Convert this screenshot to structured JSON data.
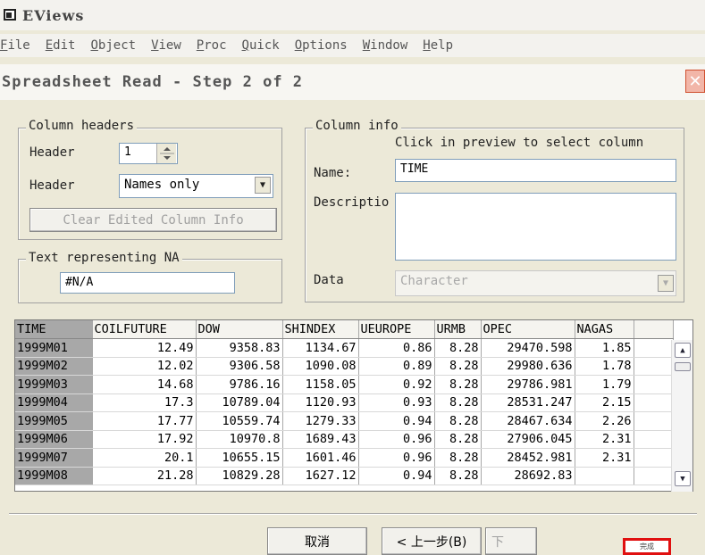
{
  "app": {
    "title": "EViews"
  },
  "menu": [
    {
      "label": "File",
      "underline": "F",
      "rest": "ile"
    },
    {
      "label": "Edit",
      "underline": "E",
      "rest": "dit"
    },
    {
      "label": "Object",
      "underline": "O",
      "rest": "bject"
    },
    {
      "label": "View",
      "underline": "V",
      "rest": "iew"
    },
    {
      "label": "Proc",
      "underline": "P",
      "rest": "roc"
    },
    {
      "label": "Quick",
      "underline": "Q",
      "rest": "uick"
    },
    {
      "label": "Options",
      "underline": "O",
      "rest": "ptions"
    },
    {
      "label": "Window",
      "underline": "W",
      "rest": "indow"
    },
    {
      "label": "Help",
      "underline": "H",
      "rest": "elp"
    }
  ],
  "dialog": {
    "title": "Spreadsheet Read - Step 2 of 2",
    "close_glyph": "✕"
  },
  "column_headers": {
    "legend": "Column headers",
    "header_label": "Header",
    "header_value": "1",
    "header_type_label": "Header",
    "header_type_value": "Names only",
    "clear_button": "Clear Edited Column Info"
  },
  "text_na": {
    "legend": "Text representing NA",
    "value": "#N/A"
  },
  "column_info": {
    "legend": "Column info",
    "hint": "Click in preview to select column",
    "name_label": "Name:",
    "name_value": "TIME",
    "description_label": "Descriptio",
    "description_value": "",
    "data_label": "Data",
    "data_value": "Character"
  },
  "grid": {
    "columns": [
      "TIME",
      "COILFUTURE",
      "DOW",
      "SHINDEX",
      "UEUROPE",
      "URMB",
      "OPEC",
      "NAGAS"
    ],
    "rows": [
      [
        "1999M01",
        "12.49",
        "9358.83",
        "1134.67",
        "0.86",
        "8.28",
        "29470.598",
        "1.85"
      ],
      [
        "1999M02",
        "12.02",
        "9306.58",
        "1090.08",
        "0.89",
        "8.28",
        "29980.636",
        "1.78"
      ],
      [
        "1999M03",
        "14.68",
        "9786.16",
        "1158.05",
        "0.92",
        "8.28",
        "29786.981",
        "1.79"
      ],
      [
        "1999M04",
        "17.3",
        "10789.04",
        "1120.93",
        "0.93",
        "8.28",
        "28531.247",
        "2.15"
      ],
      [
        "1999M05",
        "17.77",
        "10559.74",
        "1279.33",
        "0.94",
        "8.28",
        "28467.634",
        "2.26"
      ],
      [
        "1999M06",
        "17.92",
        "10970.8",
        "1689.43",
        "0.96",
        "8.28",
        "27906.045",
        "2.31"
      ],
      [
        "1999M07",
        "20.1",
        "10655.15",
        "1601.46",
        "0.96",
        "8.28",
        "28452.981",
        "2.31"
      ],
      [
        "1999M08",
        "21.28",
        "10829.28",
        "1627.12",
        "0.94",
        "8.28",
        "28692.83",
        ""
      ]
    ]
  },
  "footer": {
    "cancel": "取消",
    "back": "< 上一步(B)",
    "next": "下",
    "corner_label": "完成"
  }
}
